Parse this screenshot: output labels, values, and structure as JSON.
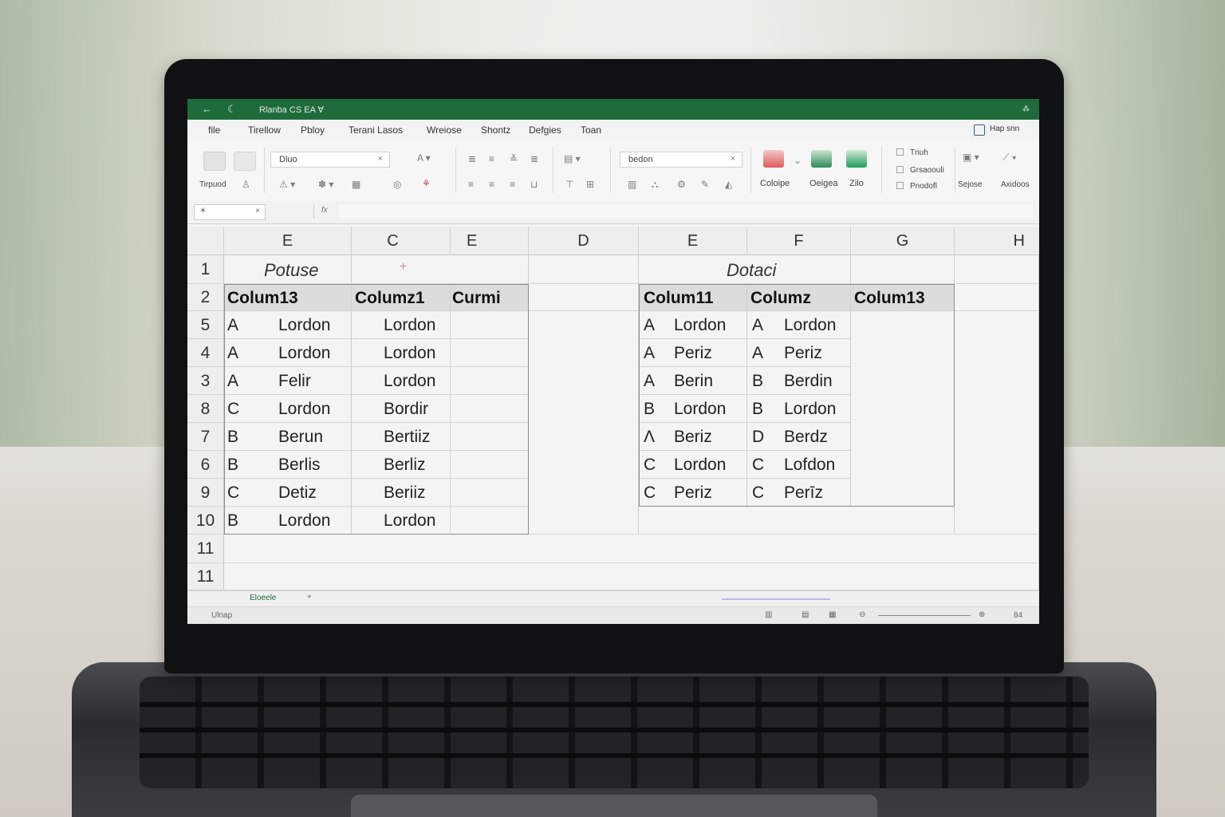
{
  "window": {
    "title": "Rlanba CS EA ∀",
    "back_glyph": "←",
    "app_glyph": "☾",
    "right_text": "⁂"
  },
  "menu": [
    "file",
    "Tirellow",
    "Pbloy",
    "Terani Lasos",
    "Wreiose",
    "Shontz",
    "Defgies",
    "Toan"
  ],
  "share": {
    "icon": "share-icon",
    "label": "Hap snn"
  },
  "ribbon": {
    "paste_label": "Tirpuod",
    "font_box": "Dluo",
    "search_box": "bedon",
    "close_glyph": "×",
    "conditional_label": "Coloipe",
    "format_label": "Oeigea",
    "cell_styles_label": "Zilo",
    "option1": "Tnuh",
    "option2": "Grsaoouli",
    "option3": "Pnodofl",
    "insert_label": "Sejose",
    "analyze_label": "Axidoos"
  },
  "formula": {
    "name_box": "☀",
    "close_glyph": "×",
    "fx_glyph": "fx"
  },
  "grid": {
    "columns": [
      "E",
      "C",
      "E",
      "D",
      "E",
      "F",
      "G",
      "H"
    ],
    "rows": [
      "1",
      "2",
      "5",
      "4",
      "3",
      "8",
      "7",
      "6",
      "9",
      "10",
      "11",
      "11"
    ],
    "left_table": {
      "title": "Potuse",
      "marker": "+",
      "headers": [
        "Colum13",
        "Columz1",
        "Curmi"
      ],
      "data": [
        [
          "A",
          "Lordon",
          "Lordon"
        ],
        [
          "A",
          "Lordon",
          "Lordon"
        ],
        [
          "A",
          "Felir",
          "Lordon"
        ],
        [
          "C",
          "Lordon",
          "Bordir"
        ],
        [
          "B",
          "Berun",
          "Bertiiz"
        ],
        [
          "B",
          "Berlis",
          "Berliz"
        ],
        [
          "C",
          "Detiz",
          "Beriiz"
        ],
        [
          "B",
          "Lordon",
          "Lordon"
        ]
      ]
    },
    "right_table": {
      "title": "Dotaci",
      "headers": [
        "Colum11",
        "Columz",
        "Colum13"
      ],
      "data": [
        [
          "A",
          "Lordon",
          "A",
          "Lordon"
        ],
        [
          "A",
          "Periz",
          "A",
          "Periz"
        ],
        [
          "A",
          "Berin",
          "B",
          "Berdin"
        ],
        [
          "B",
          "Lordon",
          "B",
          "Lordon"
        ],
        [
          "Λ",
          "Beriz",
          "D",
          "Berdz"
        ],
        [
          "C",
          "Lordon",
          "C",
          "Lofdon"
        ],
        [
          "C",
          "Periz",
          "C",
          "Perīz"
        ]
      ]
    }
  },
  "sheet_tab": {
    "name": "Eloeele",
    "add": "+"
  },
  "status": {
    "ready": "Ulnap",
    "zoom": "84"
  },
  "colors": {
    "brand": "#1f6b3c",
    "header_fill": "#dcdcdc"
  }
}
